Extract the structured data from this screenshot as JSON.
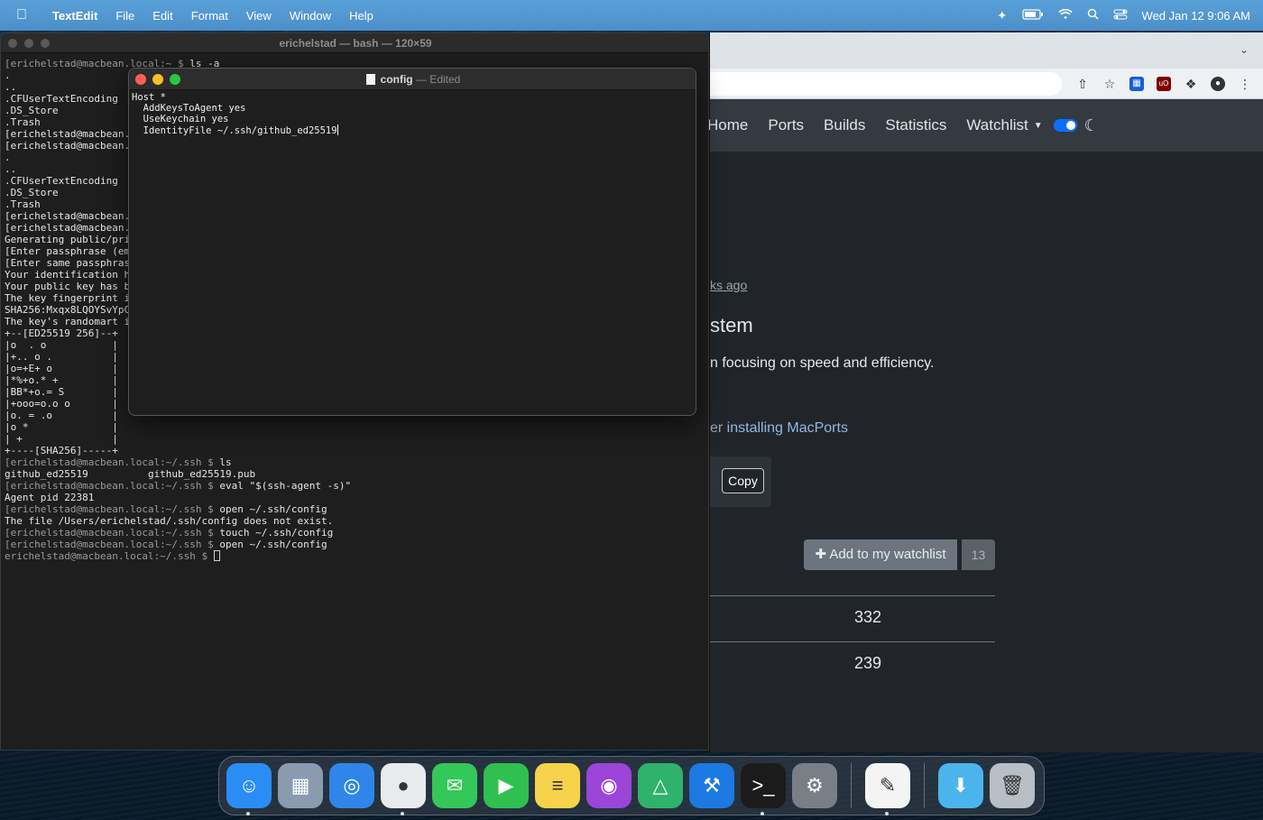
{
  "menubar": {
    "app_name": "TextEdit",
    "menus": [
      "File",
      "Edit",
      "Format",
      "View",
      "Window",
      "Help"
    ],
    "clock": "Wed Jan 12  9:06 AM"
  },
  "browser": {
    "nav": {
      "home": "Home",
      "ports": "Ports",
      "builds": "Builds",
      "statistics": "Statistics",
      "watchlist": "Watchlist"
    },
    "content": {
      "ago": "ks ago",
      "heading": "stem",
      "description": "n focusing on speed and efficiency.",
      "install_prefix": "er ",
      "install_link": "installing MacPorts",
      "copy_label": "Copy",
      "watch_label": "Add to my watchlist",
      "watch_count": "13",
      "stat1": "332",
      "stat2": "239"
    }
  },
  "terminal": {
    "title": "erichelstad — bash — 120×59",
    "lines": [
      "[erichelstad@macbean.local:~ $ ls -a",
      ".",
      "..",
      ".CFUserTextEncoding",
      ".DS_Store",
      ".Trash",
      "[erichelstad@macbean.l",
      "[erichelstad@macbean.l",
      ".",
      "..",
      ".CFUserTextEncoding",
      ".DS_Store",
      ".Trash",
      "[erichelstad@macbean.l",
      "[erichelstad@macbean.l",
      "Generating public/pri",
      "[Enter passphrase (emp",
      "[Enter same passphrase",
      "Your identification h",
      "Your public key has b",
      "The key fingerprint i",
      "SHA256:Mxqx8LQOYSvYpC",
      "The key's randomart i",
      "+--[ED25519 256]--+",
      "|o  . o           |",
      "|+.. o .          |",
      "|o=+E+ o          |",
      "|*%+o.* +         |",
      "|BB*+o.= S        |",
      "|+ooo=o.o o       |",
      "|o. = .o          |",
      "|o *              |",
      "| +               |",
      "+----[SHA256]-----+",
      "[erichelstad@macbean.local:~/.ssh $ ls",
      "github_ed25519          github_ed25519.pub",
      "[erichelstad@macbean.local:~/.ssh $ eval \"$(ssh-agent -s)\"",
      "Agent pid 22381",
      "[erichelstad@macbean.local:~/.ssh $ open ~/.ssh/config",
      "The file /Users/erichelstad/.ssh/config does not exist.",
      "[erichelstad@macbean.local:~/.ssh $ touch ~/.ssh/config",
      "[erichelstad@macbean.local:~/.ssh $ open ~/.ssh/config",
      "erichelstad@macbean.local:~/.ssh $ "
    ]
  },
  "textedit": {
    "filename": "config",
    "status": " — Edited",
    "lines": [
      "Host *",
      "  AddKeysToAgent yes",
      "  UseKeychain yes",
      "  IdentityFile ~/.ssh/github_ed25519"
    ]
  },
  "dock": {
    "apps": [
      {
        "name": "finder-icon",
        "color": "#2a8df5",
        "glyph": "☺",
        "running": true
      },
      {
        "name": "launchpad-icon",
        "color": "#8a9bb0",
        "glyph": "▦",
        "running": false
      },
      {
        "name": "safari-icon",
        "color": "#2f86e8",
        "glyph": "◎",
        "running": false
      },
      {
        "name": "chrome-icon",
        "color": "#e8eaed",
        "glyph": "●",
        "running": true
      },
      {
        "name": "messages-icon",
        "color": "#34c759",
        "glyph": "✉",
        "running": false
      },
      {
        "name": "facetime-icon",
        "color": "#30c04f",
        "glyph": "▶",
        "running": false
      },
      {
        "name": "notes-icon",
        "color": "#f7d34b",
        "glyph": "≡",
        "running": false
      },
      {
        "name": "podcasts-icon",
        "color": "#9b45d9",
        "glyph": "◉",
        "running": false
      },
      {
        "name": "gitkraken-icon",
        "color": "#2fb36b",
        "glyph": "△",
        "running": false
      },
      {
        "name": "xcode-icon",
        "color": "#1c79e2",
        "glyph": "⚒",
        "running": false
      },
      {
        "name": "terminal-icon",
        "color": "#1b1b1b",
        "glyph": ">_",
        "running": true
      },
      {
        "name": "system-preferences-icon",
        "color": "#7a7f86",
        "glyph": "⚙",
        "running": false
      }
    ],
    "after_sep": [
      {
        "name": "textedit-icon",
        "color": "#f4f4f4",
        "glyph": "✎",
        "running": true
      }
    ],
    "after_sep2": [
      {
        "name": "downloads-folder-icon",
        "color": "#4cb4ec",
        "glyph": "⬇",
        "running": false
      },
      {
        "name": "trash-icon",
        "color": "#b8bec5",
        "glyph": "🗑",
        "running": false
      }
    ]
  }
}
